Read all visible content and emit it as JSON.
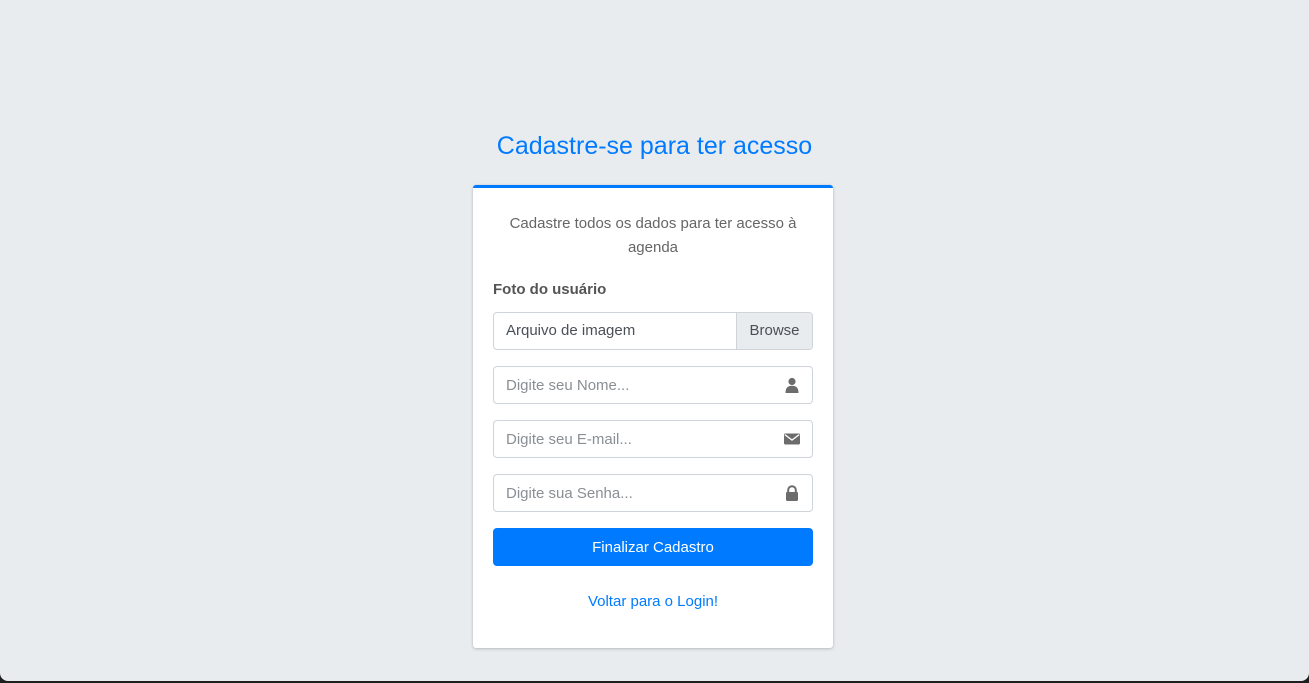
{
  "page": {
    "heading": "Cadastre-se para ter acesso"
  },
  "card": {
    "message": "Cadastre todos os dados para ter acesso à agenda",
    "photo_label": "Foto do usuário",
    "file_text": "Arquivo de imagem",
    "browse_label": "Browse",
    "name_placeholder": "Digite seu Nome...",
    "email_placeholder": "Digite seu E-mail...",
    "password_placeholder": "Digite sua Senha...",
    "submit_label": "Finalizar Cadastro",
    "back_link": "Voltar para o Login!"
  },
  "icons": {
    "name": "user-icon",
    "email": "envelope-icon",
    "password": "lock-icon"
  },
  "colors": {
    "primary": "#007bff",
    "background": "#e9ecef"
  }
}
